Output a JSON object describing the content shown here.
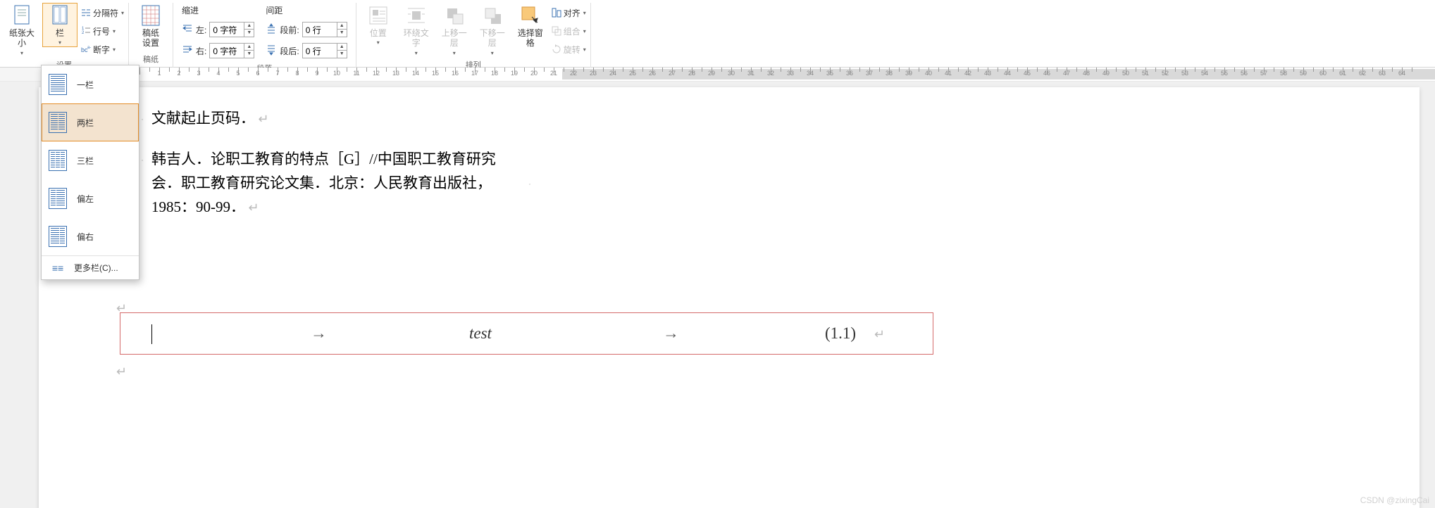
{
  "ribbon": {
    "groups": {
      "settings_label": "设置",
      "draft_label": "稿纸",
      "paragraph_label": "段落",
      "arrange_label": "排列"
    },
    "paper_size": "纸张大小",
    "columns": "栏",
    "breaks": "分隔符",
    "line_numbers": "行号",
    "hyphenation": "断字",
    "draft_settings": "稿纸\n设置",
    "indent_title": "缩进",
    "spacing_title": "间距",
    "indent_left_label": "左:",
    "indent_left_value": "0 字符",
    "indent_right_label": "右:",
    "indent_right_value": "0 字符",
    "spacing_before_label": "段前:",
    "spacing_before_value": "0 行",
    "spacing_after_label": "段后:",
    "spacing_after_value": "0 行",
    "position": "位置",
    "text_wrap": "环绕文\n字",
    "send_forward": "上移一层",
    "send_backward": "下移一层",
    "selection_pane": "选择窗格",
    "align": "对齐",
    "group": "组合",
    "rotate": "旋转"
  },
  "columns_menu": {
    "one": "一栏",
    "two": "两栏",
    "three": "三栏",
    "left": "偏左",
    "right": "偏右",
    "more": "更多栏(C)..."
  },
  "document": {
    "line1": "文献起止页码．",
    "ref1_l1": "韩吉人．论职工教育的特点［G］//中国职工教育研究",
    "ref1_l2": "会．职工教育研究论文集．北京：人民教育出版社，",
    "ref1_l3": "1985：90-99．",
    "eq_text": "test",
    "eq_num": "(1.1)",
    "tab_arrow": "→"
  },
  "watermark": "CSDN @zixingCai"
}
